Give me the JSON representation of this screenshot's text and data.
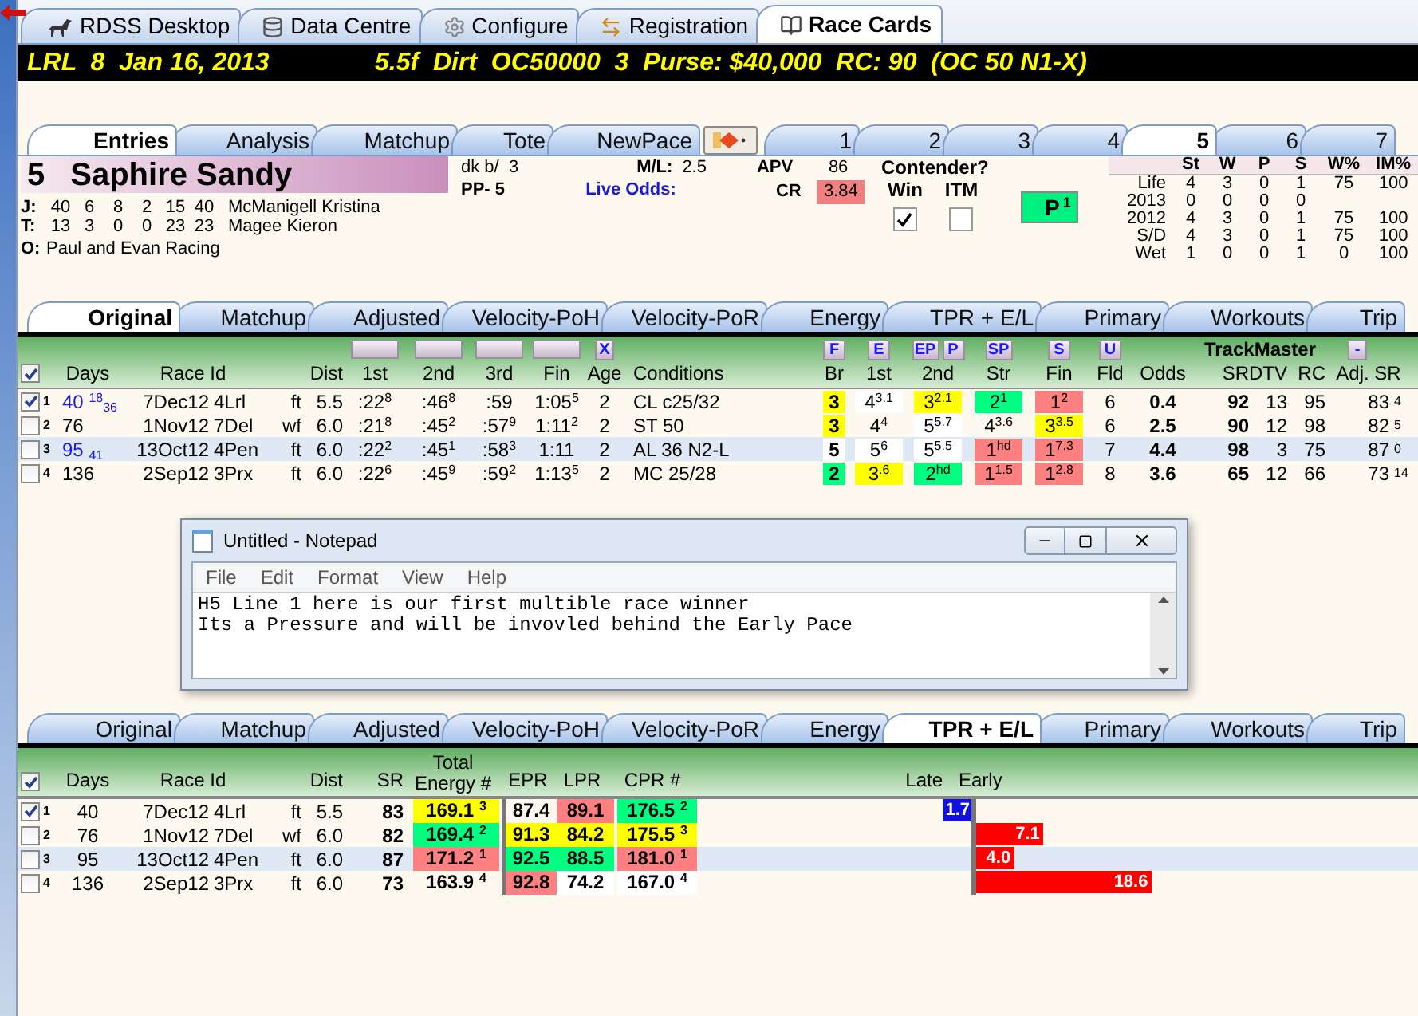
{
  "app_tabs": [
    {
      "label": "RDSS Desktop",
      "selected": false
    },
    {
      "label": "Data Centre",
      "selected": false
    },
    {
      "label": "Configure",
      "selected": false
    },
    {
      "label": "Registration",
      "selected": false
    },
    {
      "label": "Race Cards",
      "selected": true
    }
  ],
  "race_header": {
    "left": "LRL  8  Jan 16, 2013",
    "right": "5.5f  Dirt  OC50000  3  Purse: $40,000  RC: 90  (OC 50 N1-X)"
  },
  "horse_tabs": [
    {
      "label": "Entries",
      "selected": true
    },
    {
      "label": "Analysis",
      "selected": false
    },
    {
      "label": "Matchup",
      "selected": false
    },
    {
      "label": "Tote",
      "selected": false
    },
    {
      "label": "NewPace",
      "selected": false
    }
  ],
  "post_tabs": [
    {
      "label": "1",
      "selected": false
    },
    {
      "label": "2",
      "selected": false
    },
    {
      "label": "3",
      "selected": false
    },
    {
      "label": "4",
      "selected": false
    },
    {
      "label": "5",
      "selected": true
    },
    {
      "label": "6",
      "selected": false
    },
    {
      "label": "7",
      "selected": false
    }
  ],
  "horse": {
    "number": "5",
    "name": "Saphire Sandy",
    "connections": [
      {
        "role": "J:",
        "stats": [
          "40",
          "6",
          "8",
          "2",
          "15",
          "40"
        ],
        "name": "McManigell Kristina"
      },
      {
        "role": "T:",
        "stats": [
          "13",
          "3",
          "0",
          "0",
          "23",
          "23"
        ],
        "name": "Magee Kieron"
      }
    ],
    "owner_label": "O:",
    "owner": "Paul and Evan Racing",
    "color_sex": "dk b/  3",
    "pp": "PP- 5",
    "ml_label": "M/L:",
    "ml": "2.5",
    "live_odds_label": "Live Odds:",
    "apv_label": "APV",
    "apv": "86",
    "cr_label": "CR",
    "cr": "3.84",
    "contender_title": "Contender?",
    "contender": [
      {
        "label": "Win",
        "checked": true
      },
      {
        "label": "ITM",
        "checked": false
      }
    ],
    "rank_button": {
      "label": "P",
      "sup": "1"
    }
  },
  "record": {
    "columns": [
      "St",
      "W",
      "P",
      "S",
      "W%",
      "IM%"
    ],
    "rows": [
      {
        "label": "Life",
        "values": [
          "4",
          "3",
          "0",
          "1",
          "75",
          "100"
        ]
      },
      {
        "label": "2013",
        "values": [
          "0",
          "0",
          "0",
          "0"
        ]
      },
      {
        "label": "2012",
        "values": [
          "4",
          "3",
          "0",
          "1",
          "75",
          "100"
        ]
      },
      {
        "label": "S/D",
        "values": [
          "4",
          "3",
          "0",
          "1",
          "75",
          "100"
        ]
      },
      {
        "label": "Wet",
        "values": [
          "1",
          "0",
          "0",
          "1",
          "0",
          "100"
        ]
      }
    ]
  },
  "pp_tabs": [
    {
      "label": "Original",
      "selected": true
    },
    {
      "label": "Matchup",
      "selected": false
    },
    {
      "label": "Adjusted",
      "selected": false
    },
    {
      "label": "Velocity-PoH",
      "selected": false
    },
    {
      "label": "Velocity-PoR",
      "selected": false
    },
    {
      "label": "Energy",
      "selected": false
    },
    {
      "label": "TPR + E/L",
      "selected": false
    },
    {
      "label": "Primary",
      "selected": false
    },
    {
      "label": "Workouts",
      "selected": false
    },
    {
      "label": "Trip",
      "selected": false
    }
  ],
  "pp_table": {
    "x_button": "X",
    "pace_buttons": [
      "F",
      "E",
      "EP",
      "P",
      "SP",
      "S",
      "U"
    ],
    "trackmaster": "TrackMaster",
    "collapse_button": "-",
    "header_checked": true,
    "columns": [
      "Days",
      "Race Id",
      "Dist",
      "1st",
      "2nd",
      "3rd",
      "Fin",
      "Age",
      "Conditions",
      "Br",
      "1st",
      "2nd",
      "Str",
      "Fin",
      "Fld",
      "Odds",
      "SR",
      "DTV",
      "RC",
      "Adj. SR"
    ],
    "rows": [
      {
        "num": "1",
        "checked": true,
        "selected": false,
        "days": "40 $^{18}$$_{36}$",
        "days_flagged": true,
        "date": "7Dec12",
        "track": "4Lrl",
        "surface": "ft",
        "dist": "5.5",
        "fractions": [
          ":22$^{8}$",
          ":46$^{8}$",
          ":59",
          "1:05$^{5}$"
        ],
        "age": "2",
        "conditions": "CL c25/32",
        "calls": [
          {
            "text": "3",
            "color": "#ffff00"
          },
          {
            "text": "4$^{3.1}$",
            "color": "#ffffff"
          },
          {
            "text": "3$^{2.1}$",
            "color": "#ffff00"
          },
          {
            "text": "2$^{1}$",
            "color": "#00ff80"
          },
          {
            "text": "1$^{2}$",
            "color": "#ff8080"
          }
        ],
        "field": "6",
        "odds": "0.4",
        "sr": "92",
        "dtv": "13",
        "rc": "95",
        "adj_sr": "83",
        "adj_note": "4"
      },
      {
        "num": "2",
        "checked": false,
        "selected": false,
        "days": "76",
        "days_flagged": false,
        "date": "1Nov12",
        "track": "7Del",
        "surface": "wf",
        "dist": "6.0",
        "fractions": [
          ":21$^{8}$",
          ":45$^{2}$",
          ":57$^{9}$",
          "1:11$^{2}$"
        ],
        "age": "2",
        "conditions": "ST 50",
        "calls": [
          {
            "text": "3",
            "color": "#ffff00"
          },
          {
            "text": "4$^{4}$"
          },
          {
            "text": "5$^{5.7}$",
            "color": "#ffffff"
          },
          {
            "text": "4$^{3.6}$"
          },
          {
            "text": "3$^{3.5}$",
            "color": "#ffff00"
          }
        ],
        "field": "6",
        "odds": "2.5",
        "sr": "90",
        "dtv": "12",
        "rc": "98",
        "adj_sr": "82",
        "adj_note": "5"
      },
      {
        "num": "3",
        "checked": false,
        "selected": true,
        "days": "95 $_{41}$",
        "days_flagged": true,
        "date": "13Oct12",
        "track": "4Pen",
        "surface": "ft",
        "dist": "6.0",
        "fractions": [
          ":22$^{2}$",
          ":45$^{1}$",
          ":58$^{3}$",
          "1:11"
        ],
        "age": "2",
        "conditions": "AL 36 N2-L",
        "calls": [
          {
            "text": "5",
            "color": "#ffffff"
          },
          {
            "text": "5$^{6}$",
            "color": "#ffffff"
          },
          {
            "text": "5$^{5.5}$",
            "color": "#ffffff"
          },
          {
            "text": "1$^{hd}$",
            "color": "#ff8080"
          },
          {
            "text": "1$^{7.3}$",
            "color": "#ff8080"
          }
        ],
        "field": "7",
        "odds": "4.4",
        "sr": "98",
        "dtv": "3",
        "rc": "75",
        "adj_sr": "87",
        "adj_note": "0"
      },
      {
        "num": "4",
        "checked": false,
        "selected": false,
        "days": "136",
        "days_flagged": false,
        "date": "2Sep12",
        "track": "3Prx",
        "surface": "ft",
        "dist": "6.0",
        "fractions": [
          ":22$^{6}$",
          ":45$^{9}$",
          ":59$^{2}$",
          "1:13$^{5}$"
        ],
        "age": "2",
        "conditions": "MC 25/28",
        "calls": [
          {
            "text": "2",
            "color": "#00ff80"
          },
          {
            "text": "3$^{.6}$",
            "color": "#ffff00"
          },
          {
            "text": "2$^{hd}$",
            "color": "#00ff80"
          },
          {
            "text": "1$^{1.5}$",
            "color": "#ff8080"
          },
          {
            "text": "1$^{2.8}$",
            "color": "#ff8080"
          }
        ],
        "field": "8",
        "odds": "3.6",
        "sr": "65",
        "dtv": "12",
        "rc": "66",
        "adj_sr": "73",
        "adj_note": "14"
      }
    ]
  },
  "notepad": {
    "title": "Untitled - Notepad",
    "menu": [
      "File",
      "Edit",
      "Format",
      "View",
      "Help"
    ],
    "lines": [
      "H5 Line 1 here is our first multible race winner",
      "Its a Pressure and will be invovled behind the Early Pace"
    ]
  },
  "energy_tabs": [
    {
      "label": "Original",
      "selected": false
    },
    {
      "label": "Matchup",
      "selected": false
    },
    {
      "label": "Adjusted",
      "selected": false
    },
    {
      "label": "Velocity-PoH",
      "selected": false
    },
    {
      "label": "Velocity-PoR",
      "selected": false
    },
    {
      "label": "Energy",
      "selected": false
    },
    {
      "label": "TPR + E/L",
      "selected": true
    },
    {
      "label": "Primary",
      "selected": false
    },
    {
      "label": "Workouts",
      "selected": false
    },
    {
      "label": "Trip",
      "selected": false
    }
  ],
  "energy_table": {
    "header_checked": true,
    "columns": [
      "Days",
      "Race Id",
      "Dist",
      "SR",
      "Total",
      "Energy #",
      "EPR",
      "LPR",
      "CPR #",
      "Late",
      "Early"
    ],
    "rows": [
      {
        "num": "1",
        "checked": true,
        "selected": false,
        "days": "40",
        "date": "7Dec12",
        "track": "4Lrl",
        "surface": "ft",
        "dist": "5.5",
        "sr": "83",
        "energy": {
          "text": "169.1 $^{3}$",
          "color": "#ffff00"
        },
        "epr": {
          "text": "87.4"
        },
        "lpr": {
          "text": "89.1",
          "color": "#ff8080"
        },
        "cpr": {
          "text": "176.5 $^{2}$",
          "color": "#00ff80"
        },
        "bar": {
          "kind": "late",
          "value": "1.7"
        }
      },
      {
        "num": "2",
        "checked": false,
        "selected": false,
        "days": "76",
        "date": "1Nov12",
        "track": "7Del",
        "surface": "wf",
        "dist": "6.0",
        "sr": "82",
        "energy": {
          "text": "169.4 $^{2}$",
          "color": "#00ff80"
        },
        "epr": {
          "text": "91.3",
          "color": "#ffff00"
        },
        "lpr": {
          "text": "84.2",
          "color": "#ffff00"
        },
        "cpr": {
          "text": "175.5 $^{3}$",
          "color": "#ffff00"
        },
        "bar": {
          "kind": "early",
          "value": "7.1"
        }
      },
      {
        "num": "3",
        "checked": false,
        "selected": true,
        "days": "95",
        "date": "13Oct12",
        "track": "4Pen",
        "surface": "ft",
        "dist": "6.0",
        "sr": "87",
        "energy": {
          "text": "171.2 $^{1}$",
          "color": "#ff8080"
        },
        "epr": {
          "text": "92.5",
          "color": "#00ff80"
        },
        "lpr": {
          "text": "88.5",
          "color": "#00ff80"
        },
        "cpr": {
          "text": "181.0 $^{1}$",
          "color": "#ff8080"
        },
        "bar": {
          "kind": "early",
          "value": "4.0"
        }
      },
      {
        "num": "4",
        "checked": false,
        "selected": false,
        "days": "136",
        "date": "2Sep12",
        "track": "3Prx",
        "surface": "ft",
        "dist": "6.0",
        "sr": "73",
        "energy": {
          "text": "163.9 $^{4}$"
        },
        "epr": {
          "text": "92.8",
          "color": "#ff8080"
        },
        "lpr": {
          "text": "74.2",
          "color": "#ffffff"
        },
        "cpr": {
          "text": "167.0 $^{4}$",
          "color": "#ffffff"
        },
        "bar": {
          "kind": "early",
          "value": "18.6"
        }
      }
    ]
  }
}
